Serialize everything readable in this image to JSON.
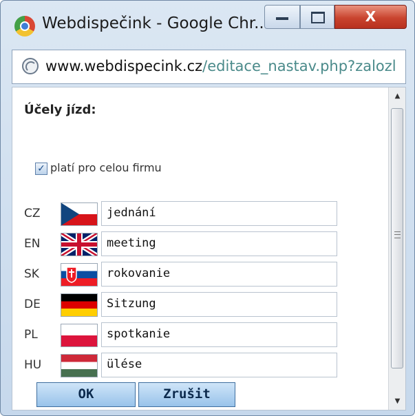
{
  "window": {
    "title": "Webdispečink - Google Chr...",
    "controls": {
      "minimize": "—",
      "maximize": "□",
      "close": "X"
    }
  },
  "address": {
    "host": "www.webdispecink.cz",
    "path": "/editace_nastav.php?zalozl"
  },
  "form": {
    "heading": "Účely jízd:",
    "checkbox": {
      "label": "platí pro celou firmu",
      "checked": true,
      "mark": "✓"
    },
    "languages": [
      {
        "code": "CZ",
        "value": "jednání"
      },
      {
        "code": "EN",
        "value": "meeting"
      },
      {
        "code": "SK",
        "value": "rokovanie"
      },
      {
        "code": "DE",
        "value": "Sitzung"
      },
      {
        "code": "PL",
        "value": "spotkanie"
      },
      {
        "code": "HU",
        "value": "ülése"
      }
    ]
  },
  "buttons": {
    "ok": "OK",
    "cancel": "Zrušit"
  },
  "scrollbar": {
    "up": "▲",
    "down": "▼"
  },
  "colors": {
    "accent": "#98c3ea",
    "close": "#c9442f"
  }
}
